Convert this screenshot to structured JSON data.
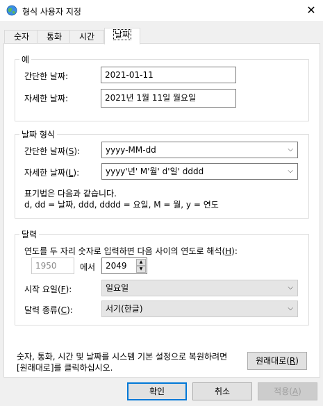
{
  "window": {
    "title": "형식 사용자 지정"
  },
  "tabs": [
    {
      "label": "숫자"
    },
    {
      "label": "통화"
    },
    {
      "label": "시간"
    },
    {
      "label": "날짜"
    }
  ],
  "example": {
    "legend": "예",
    "short_label": "간단한 날짜:",
    "short_value": "2021-01-11",
    "long_label": "자세한 날짜:",
    "long_value": "2021년 1월 11일 월요일"
  },
  "date_format": {
    "legend": "날짜 형식",
    "short_label_prefix": "간단한 날짜(",
    "short_label_key": "S",
    "short_label_suffix": "):",
    "short_value": "yyyy-MM-dd",
    "long_label_prefix": "자세한 날짜(",
    "long_label_key": "L",
    "long_label_suffix": "):",
    "long_value": "yyyy'년' M'월' d'일' dddd",
    "notation_line1": "표기법은 다음과 같습니다.",
    "notation_line2": "d, dd = 날짜,  ddd, dddd = 요일,  M = 월,  y = 연도"
  },
  "calendar": {
    "legend": "달력",
    "twodigit_prefix": "연도를 두 자리 숫자로 입력하면 다음 사이의 연도로 해석(",
    "twodigit_key": "H",
    "twodigit_suffix": "):",
    "year_from": "1950",
    "year_between": "에서",
    "year_to": "2049",
    "firstday_prefix": "시작 요일(",
    "firstday_key": "F",
    "firstday_suffix": "):",
    "firstday_value": "일요일",
    "caltype_prefix": "달력 종류(",
    "caltype_key": "C",
    "caltype_suffix": "):",
    "caltype_value": "서기(한글)"
  },
  "reset": {
    "text_line1": "숫자, 통화, 시간 및 날짜를 시스템 기본 설정으로 복원하려면",
    "text_line2": "[원래대로]를 클릭하십시오.",
    "button_prefix": "원래대로(",
    "button_key": "R",
    "button_suffix": ")"
  },
  "footer": {
    "ok": "확인",
    "cancel": "취소",
    "apply_prefix": "적용(",
    "apply_key": "A",
    "apply_suffix": ")"
  },
  "icons": {
    "app": "globe-icon",
    "close": "close-icon",
    "dropdown": "chevron-down-icon",
    "spin_up": "spin-up-icon",
    "spin_down": "spin-down-icon"
  },
  "colors": {
    "window_bg": "#f0f0f0",
    "panel_bg": "#ffffff",
    "focus_border": "#0078d7"
  }
}
